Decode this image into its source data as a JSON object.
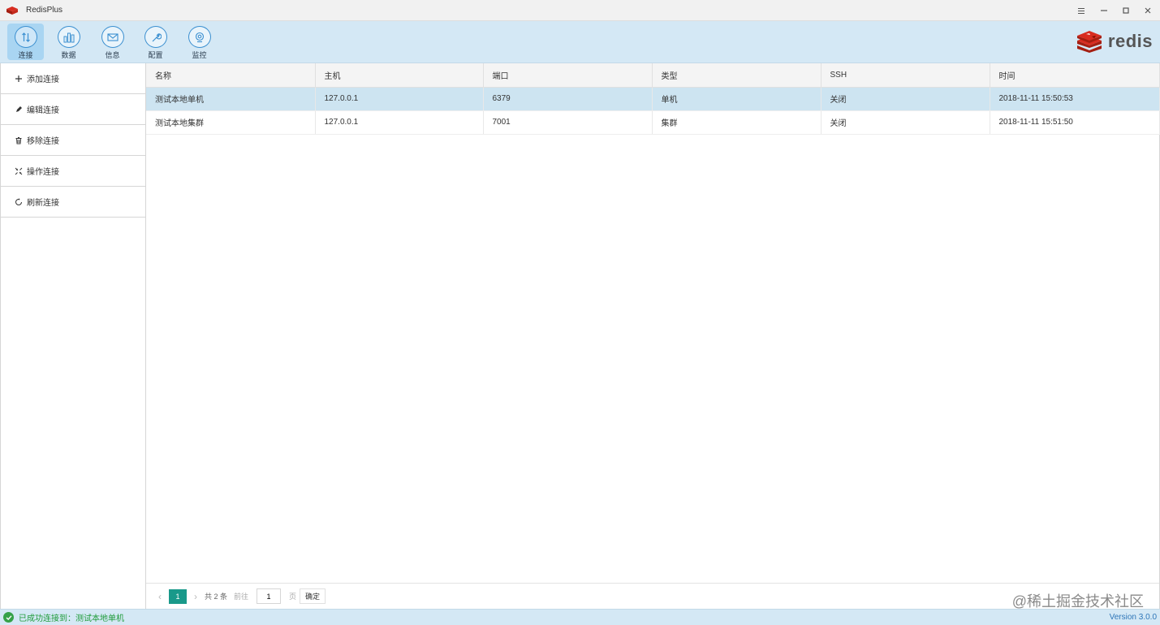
{
  "window": {
    "title": "RedisPlus",
    "icons": [
      "redis-logo-icon",
      "menu-icon",
      "minimize-icon",
      "maximize-icon",
      "close-icon"
    ]
  },
  "toolbar": {
    "items": [
      {
        "label": "连接",
        "icon": "connect-icon",
        "active": true
      },
      {
        "label": "数据",
        "icon": "chart-icon",
        "active": false
      },
      {
        "label": "信息",
        "icon": "mail-icon",
        "active": false
      },
      {
        "label": "配置",
        "icon": "wrench-icon",
        "active": false
      },
      {
        "label": "监控",
        "icon": "monitor-icon",
        "active": false
      }
    ],
    "brand": "redis"
  },
  "sidebar": {
    "items": [
      {
        "label": "添加连接",
        "icon": "plus-icon"
      },
      {
        "label": "编辑连接",
        "icon": "pencil-icon"
      },
      {
        "label": "移除连接",
        "icon": "trash-icon"
      },
      {
        "label": "操作连接",
        "icon": "operate-icon"
      },
      {
        "label": "刷新连接",
        "icon": "refresh-icon"
      }
    ]
  },
  "table": {
    "columns": [
      "名称",
      "主机",
      "端口",
      "类型",
      "SSH",
      "时间"
    ],
    "rows": [
      [
        "测试本地单机",
        "127.0.0.1",
        "6379",
        "单机",
        "关闭",
        "2018-11-11 15:50:53"
      ],
      [
        "测试本地集群",
        "127.0.0.1",
        "7001",
        "集群",
        "关闭",
        "2018-11-11 15:51:50"
      ]
    ],
    "selected_row": 0
  },
  "pager": {
    "current_page": "1",
    "total": "共 2 条",
    "goto_label": "前往",
    "page_input": "1",
    "page_unit": "页",
    "confirm": "确定"
  },
  "watermark": "@稀土掘金技术社区",
  "status": {
    "message": "已成功连接到：测试本地单机",
    "version": "Version 3.0.0",
    "colors": {
      "ok": "#1f9b3a",
      "version": "#2f76b8",
      "accent": "#19998a"
    }
  }
}
